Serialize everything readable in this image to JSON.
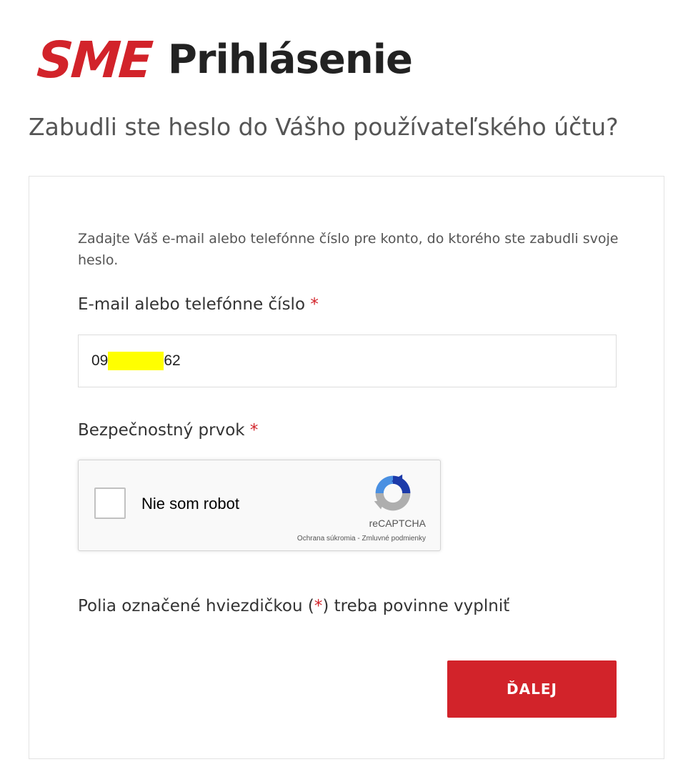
{
  "header": {
    "logo": "SME",
    "title": "Prihlásenie"
  },
  "subtitle": "Zabudli ste heslo do Vášho používateľského účtu?",
  "form": {
    "intro": "Zadajte Váš e-mail alebo telefónne číslo pre konto, do ktorého ste zabudli svoje heslo.",
    "email_label": "E-mail alebo telefónne číslo",
    "required_mark": "*",
    "email_value_prefix": "09",
    "email_value_suffix": "62",
    "captcha_label": "Bezpečnostný prvok",
    "note_prefix": "Polia označené hviezdičkou (",
    "note_suffix": ") treba povinne vyplniť",
    "submit_label": "ĎALEJ"
  },
  "recaptcha": {
    "checkbox_label": "Nie som robot",
    "brand": "reCAPTCHA",
    "links": "Ochrana súkromia - Zmluvné podmienky",
    "icon": "recaptcha-icon"
  },
  "colors": {
    "brand_red": "#d2232a",
    "redaction": "#ffff00"
  }
}
